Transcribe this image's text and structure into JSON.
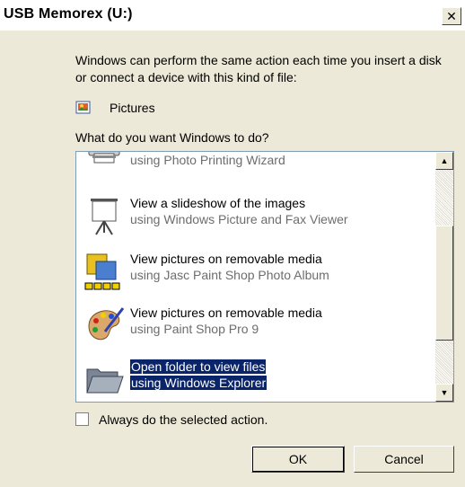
{
  "window": {
    "title": "USB Memorex (U:)",
    "close_glyph": "✕"
  },
  "description": "Windows can perform the same action each time you insert a disk or connect a device with this kind of file:",
  "file_type": {
    "icon": "pictures-icon",
    "label": "Pictures"
  },
  "question": "What do you want Windows to do?",
  "actions": [
    {
      "title": "",
      "subtitle": "using Photo Printing Wizard",
      "icon": "printer-icon",
      "selected": false
    },
    {
      "title": "View a slideshow of the images",
      "subtitle": "using Windows Picture and Fax Viewer",
      "icon": "projector-screen-icon",
      "selected": false
    },
    {
      "title": "View pictures on removable media",
      "subtitle": "using Jasc Paint Shop Photo Album",
      "icon": "photo-album-icon",
      "selected": false
    },
    {
      "title": "View pictures on removable media",
      "subtitle": "using Paint Shop Pro 9",
      "icon": "palette-icon",
      "selected": false
    },
    {
      "title": "Open folder to view files",
      "subtitle": "using Windows Explorer",
      "icon": "folder-icon",
      "selected": true
    }
  ],
  "scrollbar": {
    "up_glyph": "▲",
    "down_glyph": "▼"
  },
  "always_action": {
    "label": "Always do the selected action.",
    "checked": false
  },
  "buttons": {
    "ok": "OK",
    "cancel": "Cancel"
  },
  "colors": {
    "selection": "#0a246a",
    "dialog_bg": "#ece9d8"
  }
}
